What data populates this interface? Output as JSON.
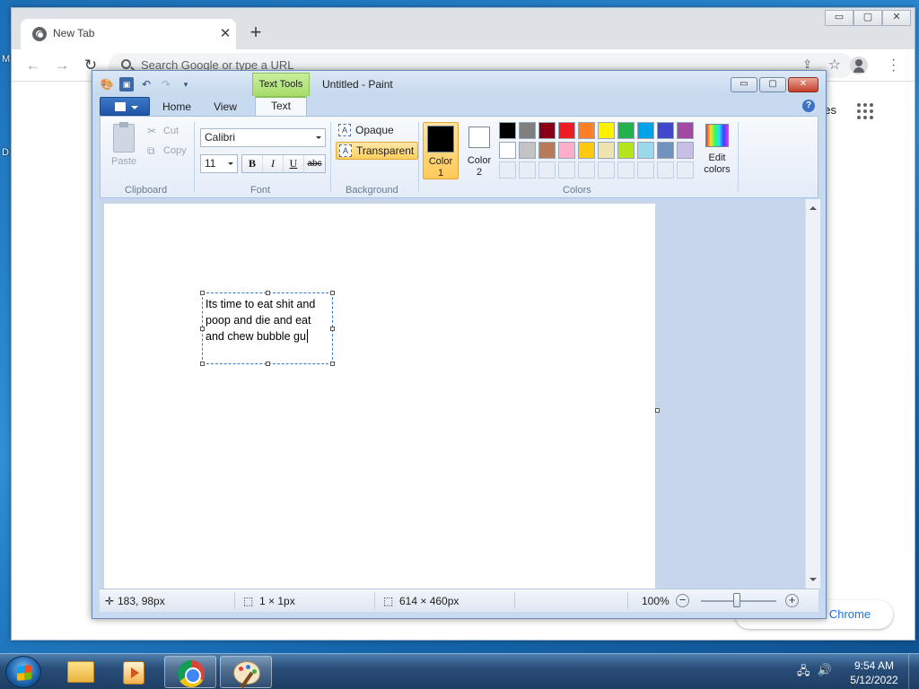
{
  "desktop": {
    "left_label_1": "M",
    "left_label_2": "D"
  },
  "chrome": {
    "tab_title": "New Tab",
    "tab_close": "✕",
    "new_tab": "+",
    "omnibox_placeholder": "Search Google or type a URL",
    "images_link": "ges",
    "customize_label": "e Chrome",
    "window_controls": [
      "▭",
      "▢",
      "✕"
    ]
  },
  "paint": {
    "title": "Untitled - Paint",
    "contextual_tab": "Text Tools",
    "tabs": [
      {
        "label": "Home",
        "active": false
      },
      {
        "label": "View",
        "active": false
      },
      {
        "label": "Text",
        "active": true
      }
    ],
    "help": "?",
    "window_controls": [
      "▭",
      "▢",
      "✕"
    ],
    "clipboard": {
      "paste": "Paste",
      "cut": "Cut",
      "copy": "Copy",
      "group_label": "Clipboard"
    },
    "font": {
      "family": "Calibri",
      "size": "11",
      "bold": "B",
      "italic": "I",
      "underline": "U",
      "strikethrough": "abc",
      "group_label": "Font"
    },
    "background": {
      "opaque": "Opaque",
      "transparent": "Transparent",
      "selected": "Transparent",
      "group_label": "Background"
    },
    "colors": {
      "color1_label_line1": "Color",
      "color1_label_line2": "1",
      "color1_value": "#000000",
      "color2_label_line1": "Color",
      "color2_label_line2": "2",
      "color2_value": "#ffffff",
      "palette_row1": [
        "#000000",
        "#7f7f7f",
        "#880015",
        "#ed1c24",
        "#ff7f27",
        "#fff200",
        "#22b14c",
        "#00a2e8",
        "#3f48cc",
        "#a349a4"
      ],
      "palette_row2": [
        "#ffffff",
        "#c3c3c3",
        "#b97a57",
        "#ffaec9",
        "#ffc90e",
        "#efe4b0",
        "#b5e61d",
        "#99d9ea",
        "#7092be",
        "#c8bfe7"
      ],
      "edit_colors_line1": "Edit",
      "edit_colors_line2": "colors",
      "group_label": "Colors"
    },
    "canvas_text": {
      "line1": "Its time to eat shit and",
      "line2": "poop and die and eat",
      "line3": "and chew bubble gu"
    },
    "status": {
      "cursor_pos": "183, 98px",
      "selection_size": "1 × 1px",
      "canvas_size": "614 × 460px",
      "zoom": "100%",
      "zoom_minus": "−",
      "zoom_plus": "+"
    }
  },
  "taskbar": {
    "time": "9:54 AM",
    "date": "5/12/2022"
  }
}
